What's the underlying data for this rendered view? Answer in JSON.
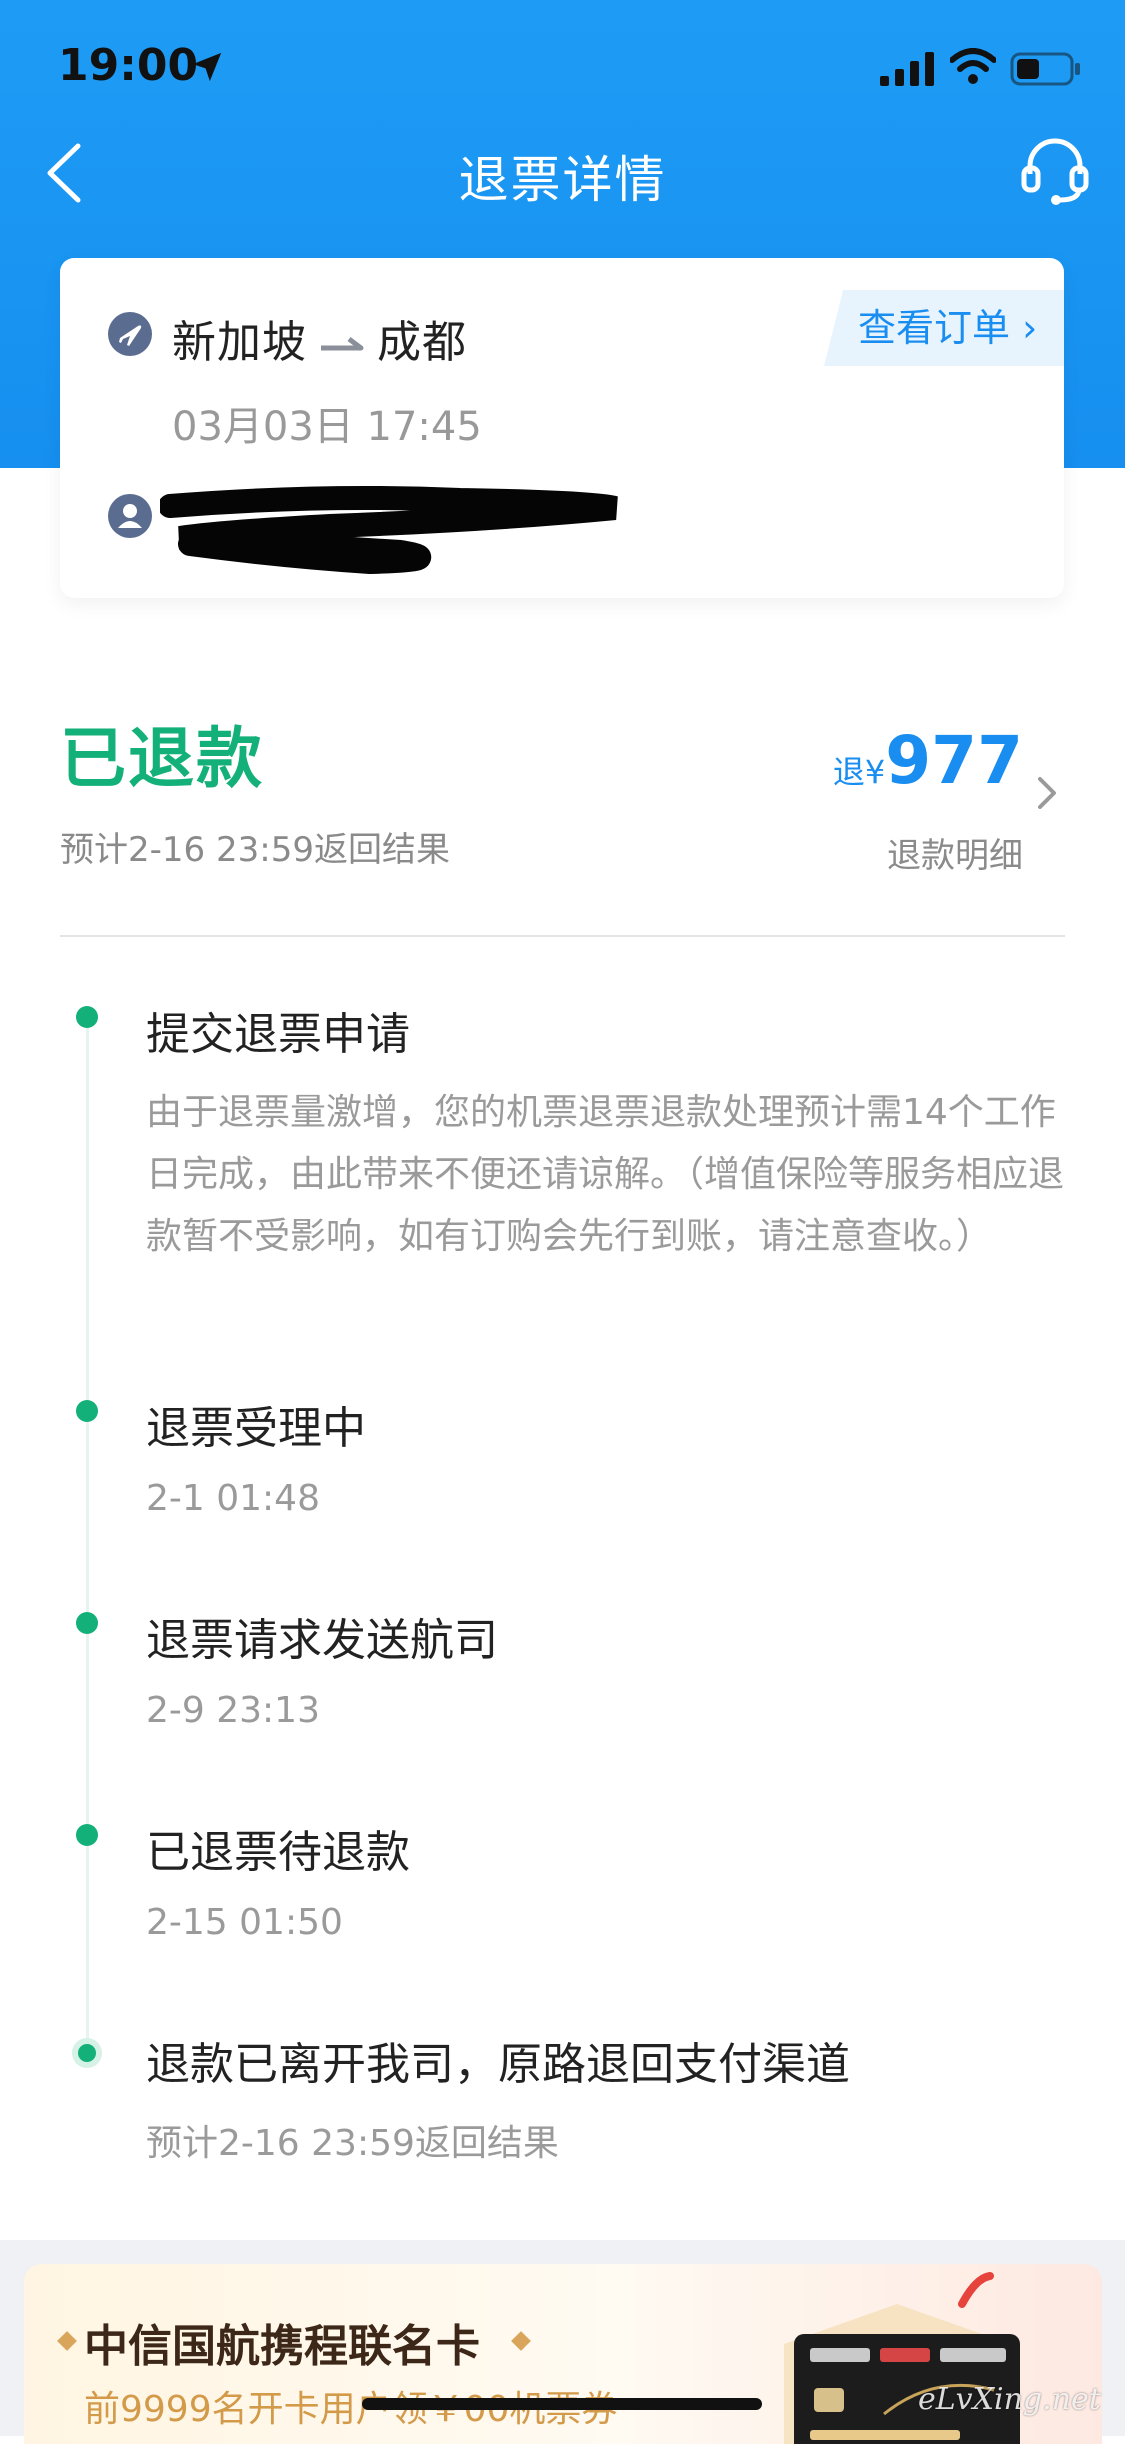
{
  "status_bar": {
    "time": "19:00"
  },
  "nav": {
    "title": "退票详情"
  },
  "flight": {
    "from": "新加坡",
    "to": "成都",
    "date": "03月03日 17:45",
    "view_order_label": "查看订单"
  },
  "refund": {
    "status": "已退款",
    "eta": "预计2-16 23:59返回结果",
    "amount_prefix": "退¥",
    "amount": "977",
    "detail_label": "退款明细"
  },
  "timeline": [
    {
      "title": "提交退票申请",
      "desc": "由于退票量激增，您的机票退票退款处理预计需14个工作日完成，由此带来不便还请谅解。（增值保险等服务相应退款暂不受影响，如有订购会先行到账，请注意查收。）"
    },
    {
      "title": "退票受理中",
      "time": "2-1 01:48"
    },
    {
      "title": "退票请求发送航司",
      "time": "2-9 23:13"
    },
    {
      "title": "已退票待退款",
      "time": "2-15 01:50"
    },
    {
      "title": "退款已离开我司，原路退回支付渠道",
      "time": "预计2-16 23:59返回结果"
    }
  ],
  "banner": {
    "title": "中信国航携程联名卡",
    "subtitle": "前9999名开卡用户领￥00机票券"
  },
  "watermark": "eLvXing.net",
  "colors": {
    "header_blue": "#1a93f3",
    "accent_blue": "#1a8ef0",
    "success_green": "#14b07a"
  }
}
